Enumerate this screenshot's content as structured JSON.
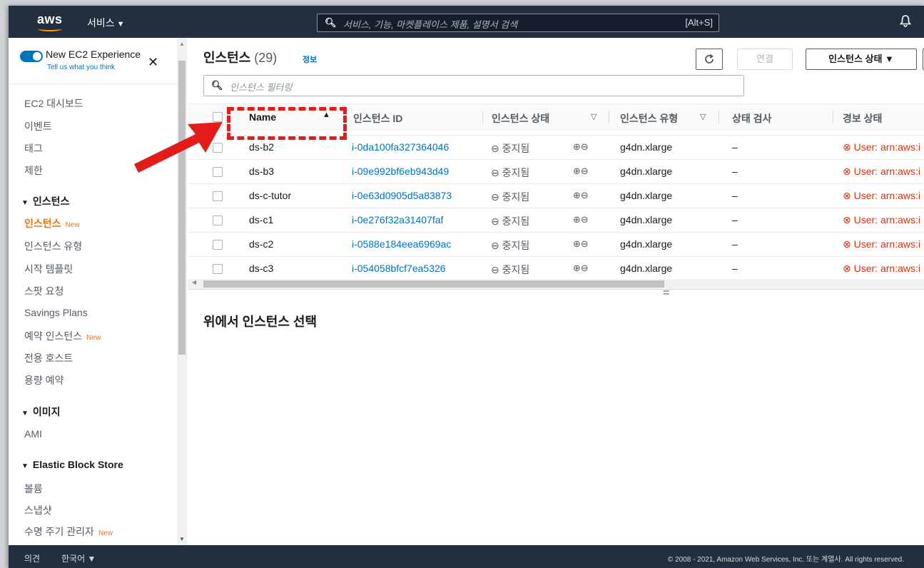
{
  "nav": {
    "logo": "aws",
    "services_label": "서비스",
    "search_placeholder": "서비스, 기능, 마켓플레이스 제품, 설명서 검색",
    "search_shortcut": "[Alt+S]",
    "bell_icon": "bell-icon"
  },
  "sidebar": {
    "experience_title": "New EC2 Experience",
    "experience_link": "Tell us what you think",
    "new_badge": "New",
    "items": {
      "dashboard": "EC2 대시보드",
      "events": "이벤트",
      "tags": "태그",
      "limits": "제한",
      "instances_section": "인스턴스",
      "instances": "인스턴스",
      "instance_types": "인스턴스 유형",
      "launch_templates": "시작 템플릿",
      "spot_requests": "스팟 요청",
      "savings_plans": "Savings Plans",
      "reserved_instances": "예약 인스턴스",
      "dedicated_hosts": "전용 호스트",
      "capacity_reservations": "용량 예약",
      "images_section": "이미지",
      "ami": "AMI",
      "ebs_section": "Elastic Block Store",
      "volumes": "볼륨",
      "snapshots": "스냅샷",
      "lifecycle_manager": "수명 주기 관리자"
    }
  },
  "main": {
    "title": "인스턴스",
    "count": "(29)",
    "info": "정보",
    "connect_label": "연결",
    "state_label": "인스턴스 상태 ▼",
    "filter_placeholder": "인스턴스 필터링",
    "columns": {
      "name": "Name",
      "id": "인스턴스 ID",
      "state": "인스턴스 상태",
      "type": "인스턴스 유형",
      "check": "상태 검사",
      "alarm": "경보 상태"
    },
    "rows": [
      {
        "name": "ds-b2",
        "id": "i-0da100fa327364046",
        "state": "중지됨",
        "type": "g4dn.xlarge",
        "check": "–",
        "alarm": "User: arn:aws:i"
      },
      {
        "name": "ds-b3",
        "id": "i-09e992bf6eb943d49",
        "state": "중지됨",
        "type": "g4dn.xlarge",
        "check": "–",
        "alarm": "User: arn:aws:i"
      },
      {
        "name": "ds-c-tutor",
        "id": "i-0e63d0905d5a83873",
        "state": "중지됨",
        "type": "g4dn.xlarge",
        "check": "–",
        "alarm": "User: arn:aws:i"
      },
      {
        "name": "ds-c1",
        "id": "i-0e276f32a31407faf",
        "state": "중지됨",
        "type": "g4dn.xlarge",
        "check": "–",
        "alarm": "User: arn:aws:i"
      },
      {
        "name": "ds-c2",
        "id": "i-0588e184eea6969ac",
        "state": "중지됨",
        "type": "g4dn.xlarge",
        "check": "–",
        "alarm": "User: arn:aws:i"
      },
      {
        "name": "ds-c3",
        "id": "i-054058bfcf7ea5326",
        "state": "중지됨",
        "type": "g4dn.xlarge",
        "check": "–",
        "alarm": "User: arn:aws:i"
      }
    ],
    "bottom_title": "위에서 인스턴스 선택"
  },
  "footer": {
    "feedback": "의견",
    "language": "한국어 ▼",
    "copyright": "© 2008 - 2021, Amazon Web Services, Inc. 또는 계열사. All rights reserved."
  },
  "colors": {
    "nav_bg": "#232f3e",
    "accent_orange": "#ec7211",
    "link_blue": "#0073bb",
    "alarm_red": "#d13212",
    "annotation_red": "#e31c19"
  }
}
